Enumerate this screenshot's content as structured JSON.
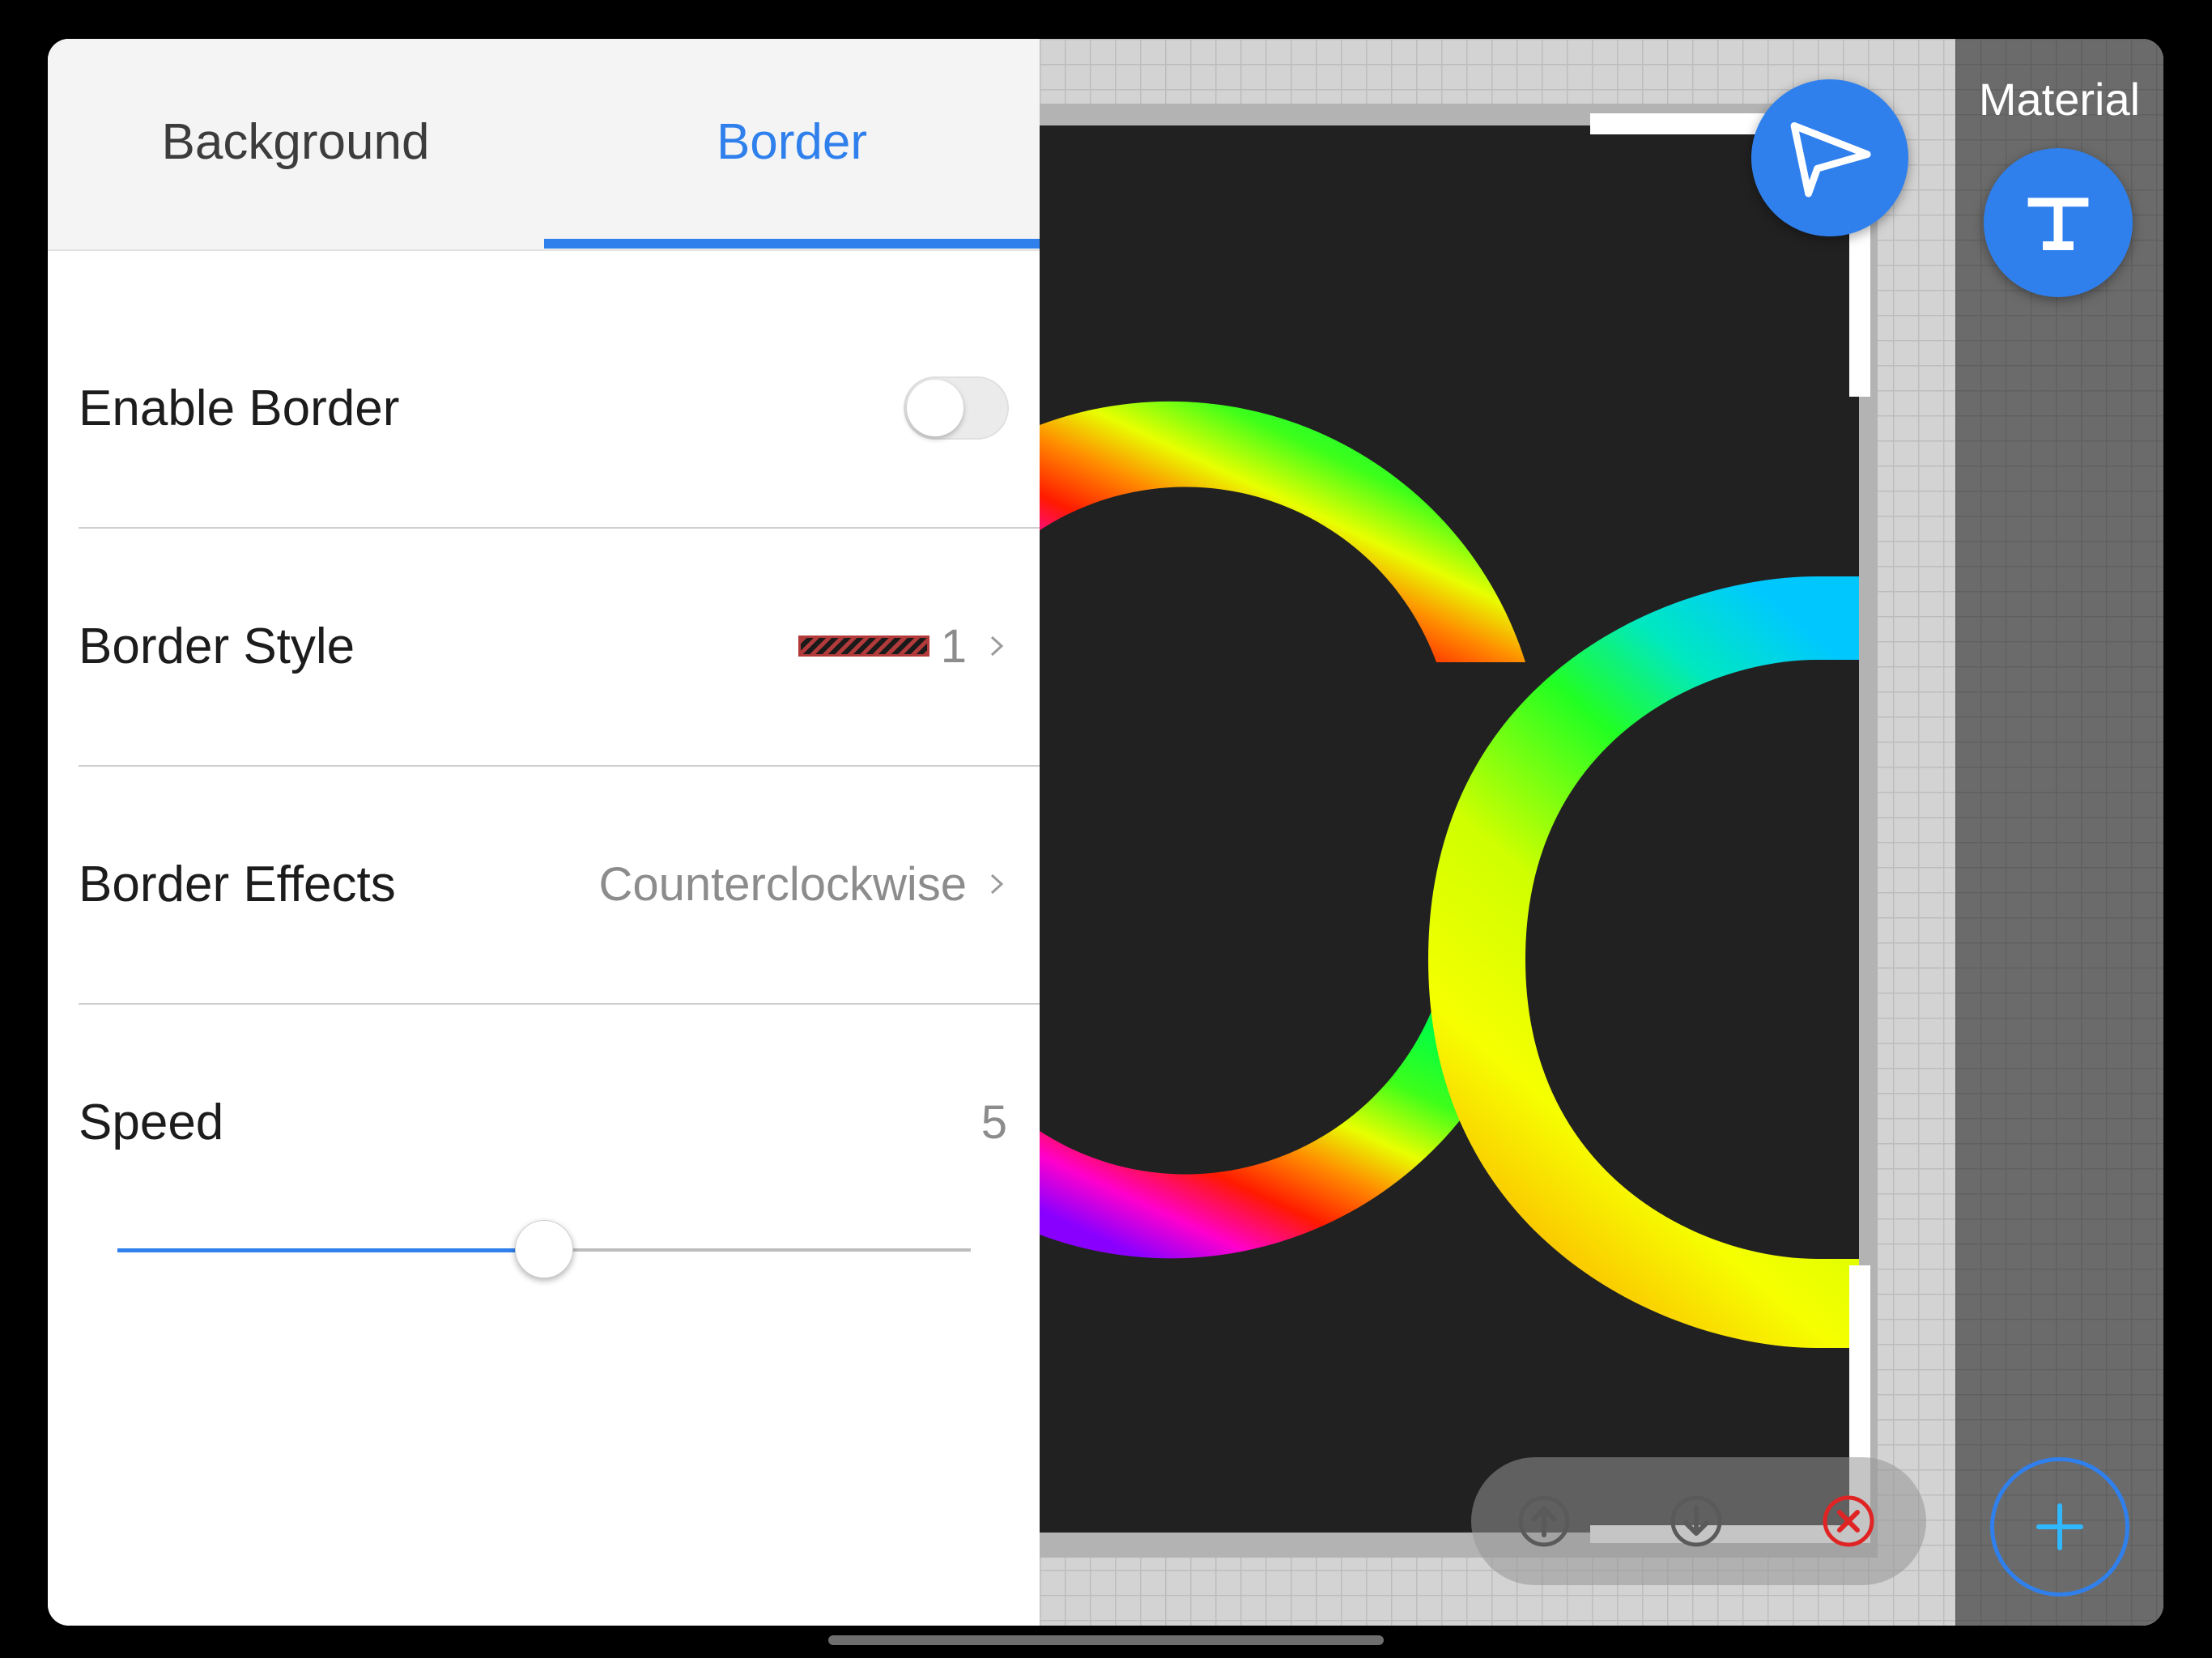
{
  "tabs": [
    {
      "label": "Background",
      "active": false
    },
    {
      "label": "Border",
      "active": true
    }
  ],
  "rows": {
    "enable_border": {
      "label": "Enable Border",
      "on": false
    },
    "border_style": {
      "label": "Border Style",
      "value": "1"
    },
    "border_effects": {
      "label": "Border Effects",
      "value": "Counterclockwise"
    },
    "speed": {
      "label": "Speed",
      "value": "5",
      "slider_fraction": 0.5
    }
  },
  "sidebar": {
    "material_label": "Material"
  },
  "preview": {
    "led_text": "Co"
  },
  "icons": {
    "send": "paper-plane-icon",
    "text_tool": "text-t-icon",
    "add": "plus-icon",
    "move_up": "arrow-up-circle-icon",
    "move_down": "arrow-down-circle-icon",
    "delete": "close-circle-icon",
    "chevron": "chevron-right-icon"
  },
  "colors": {
    "accent": "#2f80ed",
    "delete": "#e02424",
    "led_background": "#212121"
  }
}
